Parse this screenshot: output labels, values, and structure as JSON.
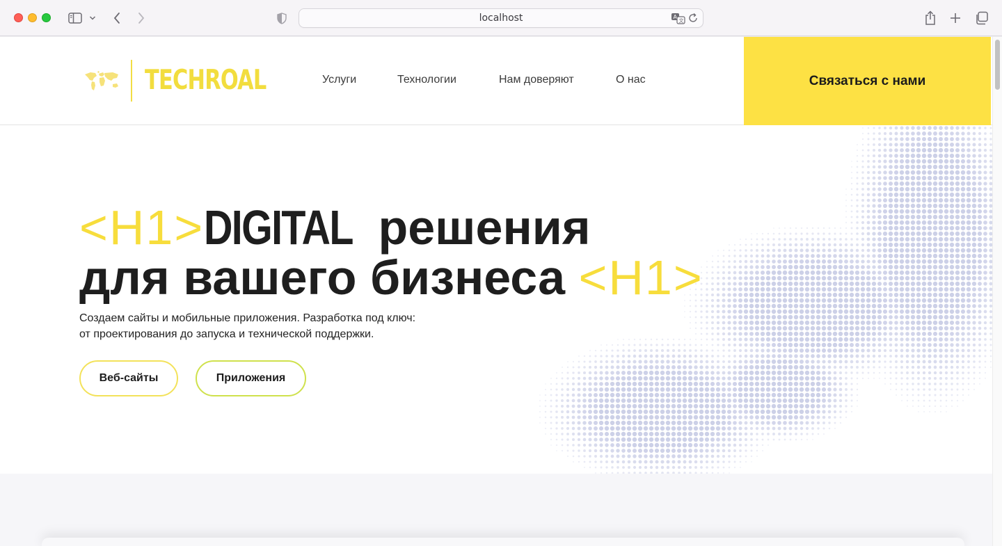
{
  "browser": {
    "url": "localhost",
    "icons": {
      "sidebar": "sidebar-icon",
      "back": "chevron-left-icon",
      "forward": "chevron-right-icon",
      "privacy": "shield-icon",
      "translate": "translate-icon",
      "reload": "reload-icon",
      "share": "share-icon",
      "new_tab": "plus-icon",
      "tabs": "tabs-overview-icon"
    }
  },
  "header": {
    "logo_text": "TECHROAL",
    "nav": [
      "Услуги",
      "Технологии",
      "Нам доверяют",
      "О нас"
    ],
    "contact_button": "Связаться с нами"
  },
  "hero": {
    "tag_open": "<H1>",
    "tag_close": "<H1>",
    "title_bold": "DIGITAL",
    "title_line1_rest": " решения",
    "title_line2": "для вашего бизнеса ",
    "description": [
      "Создаем сайты и мобильные приложения. Разработка под ключ:",
      "от проектирования до запуска и технической поддержки."
    ],
    "buttons": {
      "websites": "Веб-сайты",
      "apps": "Приложения"
    }
  },
  "colors": {
    "accent_yellow": "#fde144",
    "tag_yellow": "#f7dd3c",
    "apps_border": "#cfe14c",
    "dots": "#c9cde6"
  }
}
